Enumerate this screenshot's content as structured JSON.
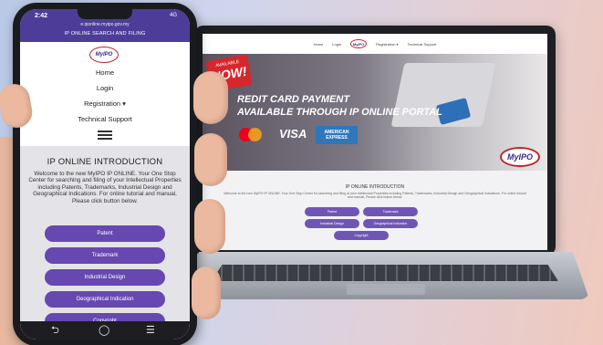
{
  "phone": {
    "status_time": "2:42",
    "status_battery": "4G",
    "url": "e.iponline.myipo.gov.my",
    "site_title": "IP ONLINE SEARCH AND FILING",
    "logo_text": "MyIPO",
    "nav": [
      "Home",
      "Login",
      "Registration ▾",
      "Technical Support"
    ],
    "intro_title": "IP ONLINE INTRODUCTION",
    "intro_text": "Welcome to the new MyIPO IP ONLINE. Your One Stop Center for searching and filing of your Intellectual Properties including Patents, Trademarks, Industrial Design and Geographical Indications. For online tutorial and manual, Please click button below.",
    "buttons": [
      "Patent",
      "Trademark",
      "Industrial Design",
      "Geographical Indication",
      "Copyright"
    ]
  },
  "laptop": {
    "nav": [
      "Home",
      "Login",
      "Registration ▾",
      "Technical Support"
    ],
    "logo_text": "MyIPO",
    "badge_small_top": "AVAILABLE",
    "badge_big": "NOW!",
    "banner_line1": "REDIT CARD PAYMENT",
    "banner_line2": "AVAILABLE THROUGH IP ONLINE PORTAL",
    "card_visa": "VISA",
    "card_amex": "AMERICAN EXPRESS",
    "intro_title": "IP ONLINE INTRODUCTION",
    "intro_text": "Welcome to the new MyIPO IP ONLINE. Your One Stop Center for searching and filing of your Intellectual Properties including Patents, Trademarks, Industrial Design and Geographical Indications. For online tutorial and manual, Please click button below.",
    "buttons": [
      "Patent",
      "Trademark",
      "Industrial Design",
      "Geographical Indication",
      "Copyright"
    ]
  },
  "colors": {
    "brand_purple": "#6648b0",
    "header_purple": "#4d3d98",
    "accent_red": "#d6272c"
  },
  "icons": {
    "phone_back": "back-icon",
    "phone_home": "home-icon",
    "phone_recents": "recents-icon",
    "menu": "hamburger-icon"
  }
}
